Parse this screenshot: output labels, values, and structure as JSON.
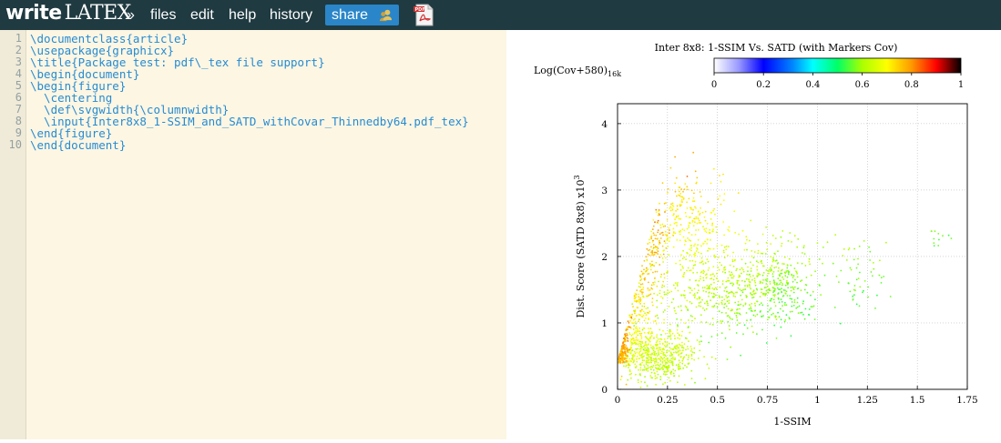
{
  "topbar": {
    "logo_text": "write",
    "logo_latex": "LATEX",
    "nav_arrow": "»",
    "nav_items": [
      "files",
      "edit",
      "help",
      "history"
    ],
    "share_label": "share",
    "share_icon": "group-icon",
    "pdf_icon": "pdf-icon"
  },
  "editor": {
    "line_numbers": [
      "1",
      "2",
      "3",
      "4",
      "5",
      "6",
      "7",
      "8",
      "9",
      "10"
    ],
    "lines": [
      "\\documentclass{article}",
      "\\usepackage{graphicx}",
      "\\title{Package test: pdf\\_tex file support}",
      "\\begin{document}",
      "\\begin{figure}",
      "  \\centering",
      "  \\def\\svgwidth{\\columnwidth}",
      "  \\input{Inter8x8_1-SSIM_and_SATD_withCovar_Thinnedby64.pdf_tex}",
      "\\end{figure}",
      "\\end{document}"
    ],
    "background": "#fdf6e3",
    "text_color": "#268bd2"
  },
  "chart_data": {
    "type": "scatter",
    "title": "Inter 8x8: 1-SSIM Vs. SATD (with Markers Cov)",
    "xlabel": "1-SSIM",
    "ylabel_text": "Dist. Score (SATD 8x8) x10",
    "ylabel_sup": "3",
    "colorbar_label_text": "Log(Cov+580)",
    "colorbar_label_sub": "16k",
    "colorbar_ticks": [
      "0",
      "0.2",
      "0.4",
      "0.6",
      "0.8",
      "1"
    ],
    "colorbar_range": [
      0,
      1
    ],
    "xlim": [
      0,
      1.75
    ],
    "ylim": [
      0,
      4.3
    ],
    "x_ticks": [
      "0",
      "0.25",
      "0.5",
      "0.75",
      "1",
      "1.25",
      "1.5",
      "1.75"
    ],
    "y_ticks": [
      "0",
      "1",
      "2",
      "3",
      "4"
    ],
    "grid": true,
    "point_clusters": [
      {
        "x_center": 0.12,
        "y_center": 2.2,
        "x_spread": 0.12,
        "y_spread": 1.0,
        "color_value": 0.78,
        "count": 320
      },
      {
        "x_center": 0.35,
        "y_center": 2.5,
        "x_spread": 0.2,
        "y_spread": 0.8,
        "color_value": 0.7,
        "count": 280
      },
      {
        "x_center": 0.5,
        "y_center": 1.5,
        "x_spread": 0.35,
        "y_spread": 0.7,
        "color_value": 0.62,
        "count": 500
      },
      {
        "x_center": 0.8,
        "y_center": 1.6,
        "x_spread": 0.2,
        "y_spread": 0.6,
        "color_value": 0.58,
        "count": 300
      },
      {
        "x_center": 0.2,
        "y_center": 0.5,
        "x_spread": 0.2,
        "y_spread": 0.4,
        "color_value": 0.64,
        "count": 520
      },
      {
        "x_center": 0.03,
        "y_center": 1.2,
        "x_spread": 0.03,
        "y_spread": 0.9,
        "color_value": 0.82,
        "count": 150
      },
      {
        "x_center": 1.2,
        "y_center": 1.7,
        "x_spread": 0.15,
        "y_spread": 0.6,
        "color_value": 0.57,
        "count": 60
      },
      {
        "x_center": 1.6,
        "y_center": 2.3,
        "x_spread": 0.05,
        "y_spread": 0.15,
        "color_value": 0.55,
        "count": 12
      }
    ]
  }
}
